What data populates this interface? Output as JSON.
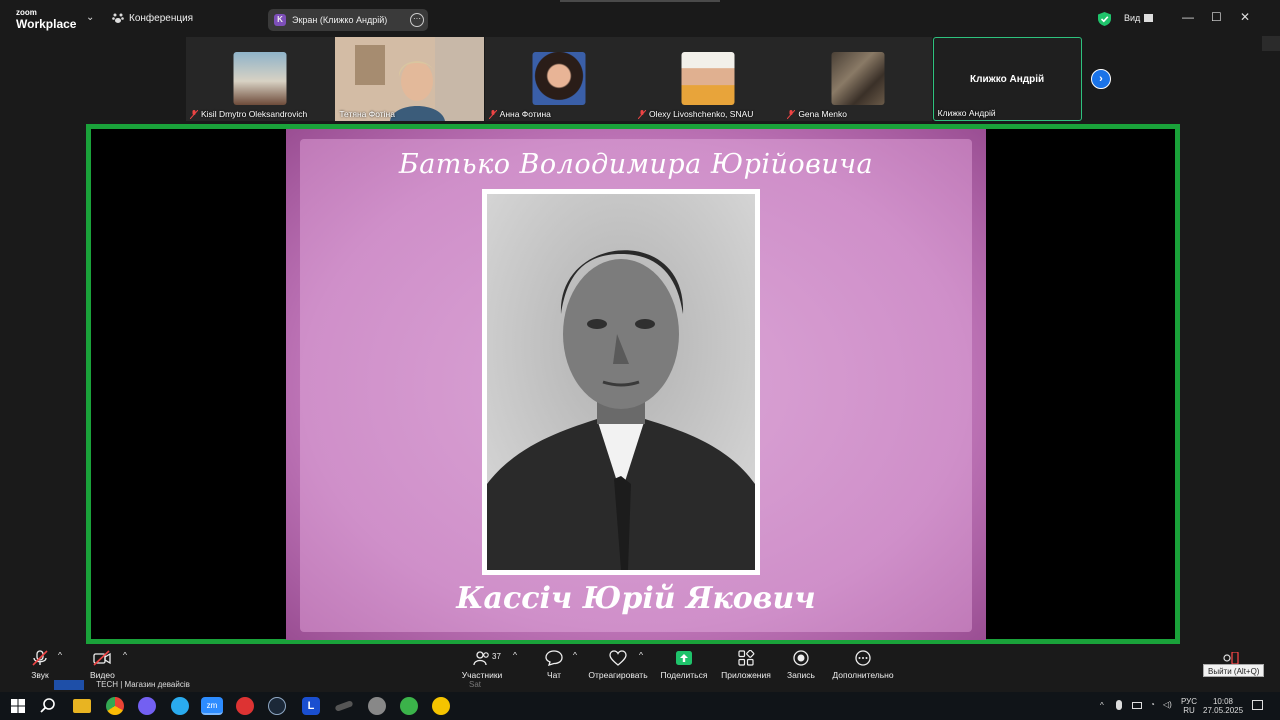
{
  "window": {
    "logo_line1": "zoom",
    "logo_line2": "Workplace",
    "conference_label": "Конференция",
    "share_pill_badge": "K",
    "share_pill_label": "Экран (Клижко Андрій)",
    "view_label": "Вид"
  },
  "participants": [
    {
      "name": "Kisil Dmytro Oleksandrovich",
      "muted": true
    },
    {
      "name": "Тетяна Фотіна",
      "muted": false
    },
    {
      "name": "Анна Фотина",
      "muted": true
    },
    {
      "name": "Olexy Livoshchenko, SNAU",
      "muted": true
    },
    {
      "name": "Gena Menko",
      "muted": true
    },
    {
      "name": "Клижко Андрій",
      "muted": false,
      "active": true,
      "center_label": "Клижко Андрій"
    }
  ],
  "slide": {
    "title": "Батько Володимира Юрійовича",
    "name": "Кассіч Юрій Якович"
  },
  "toolbar": {
    "audio": "Звук",
    "video": "Видео",
    "participants": "Участники",
    "participants_count": "37",
    "chat": "Чат",
    "react": "Отреагировать",
    "share": "Поделиться",
    "apps": "Приложения",
    "record": "Запись",
    "more": "Дополнительно",
    "leave_tooltip": "Выйти (Alt+Q)"
  },
  "colors": {
    "share_border": "#1aa23a",
    "active_tile_border": "#2ec27e",
    "share_button_green": "#1fc36b",
    "next_button_blue": "#1a73e8"
  },
  "behind_window": {
    "text": "TECH | Магазин девайсів",
    "sat": "Sat"
  },
  "taskbar": {
    "lang_top": "РУС",
    "lang_bottom": "RU",
    "time": "10:08",
    "date": "27.05.2025"
  }
}
